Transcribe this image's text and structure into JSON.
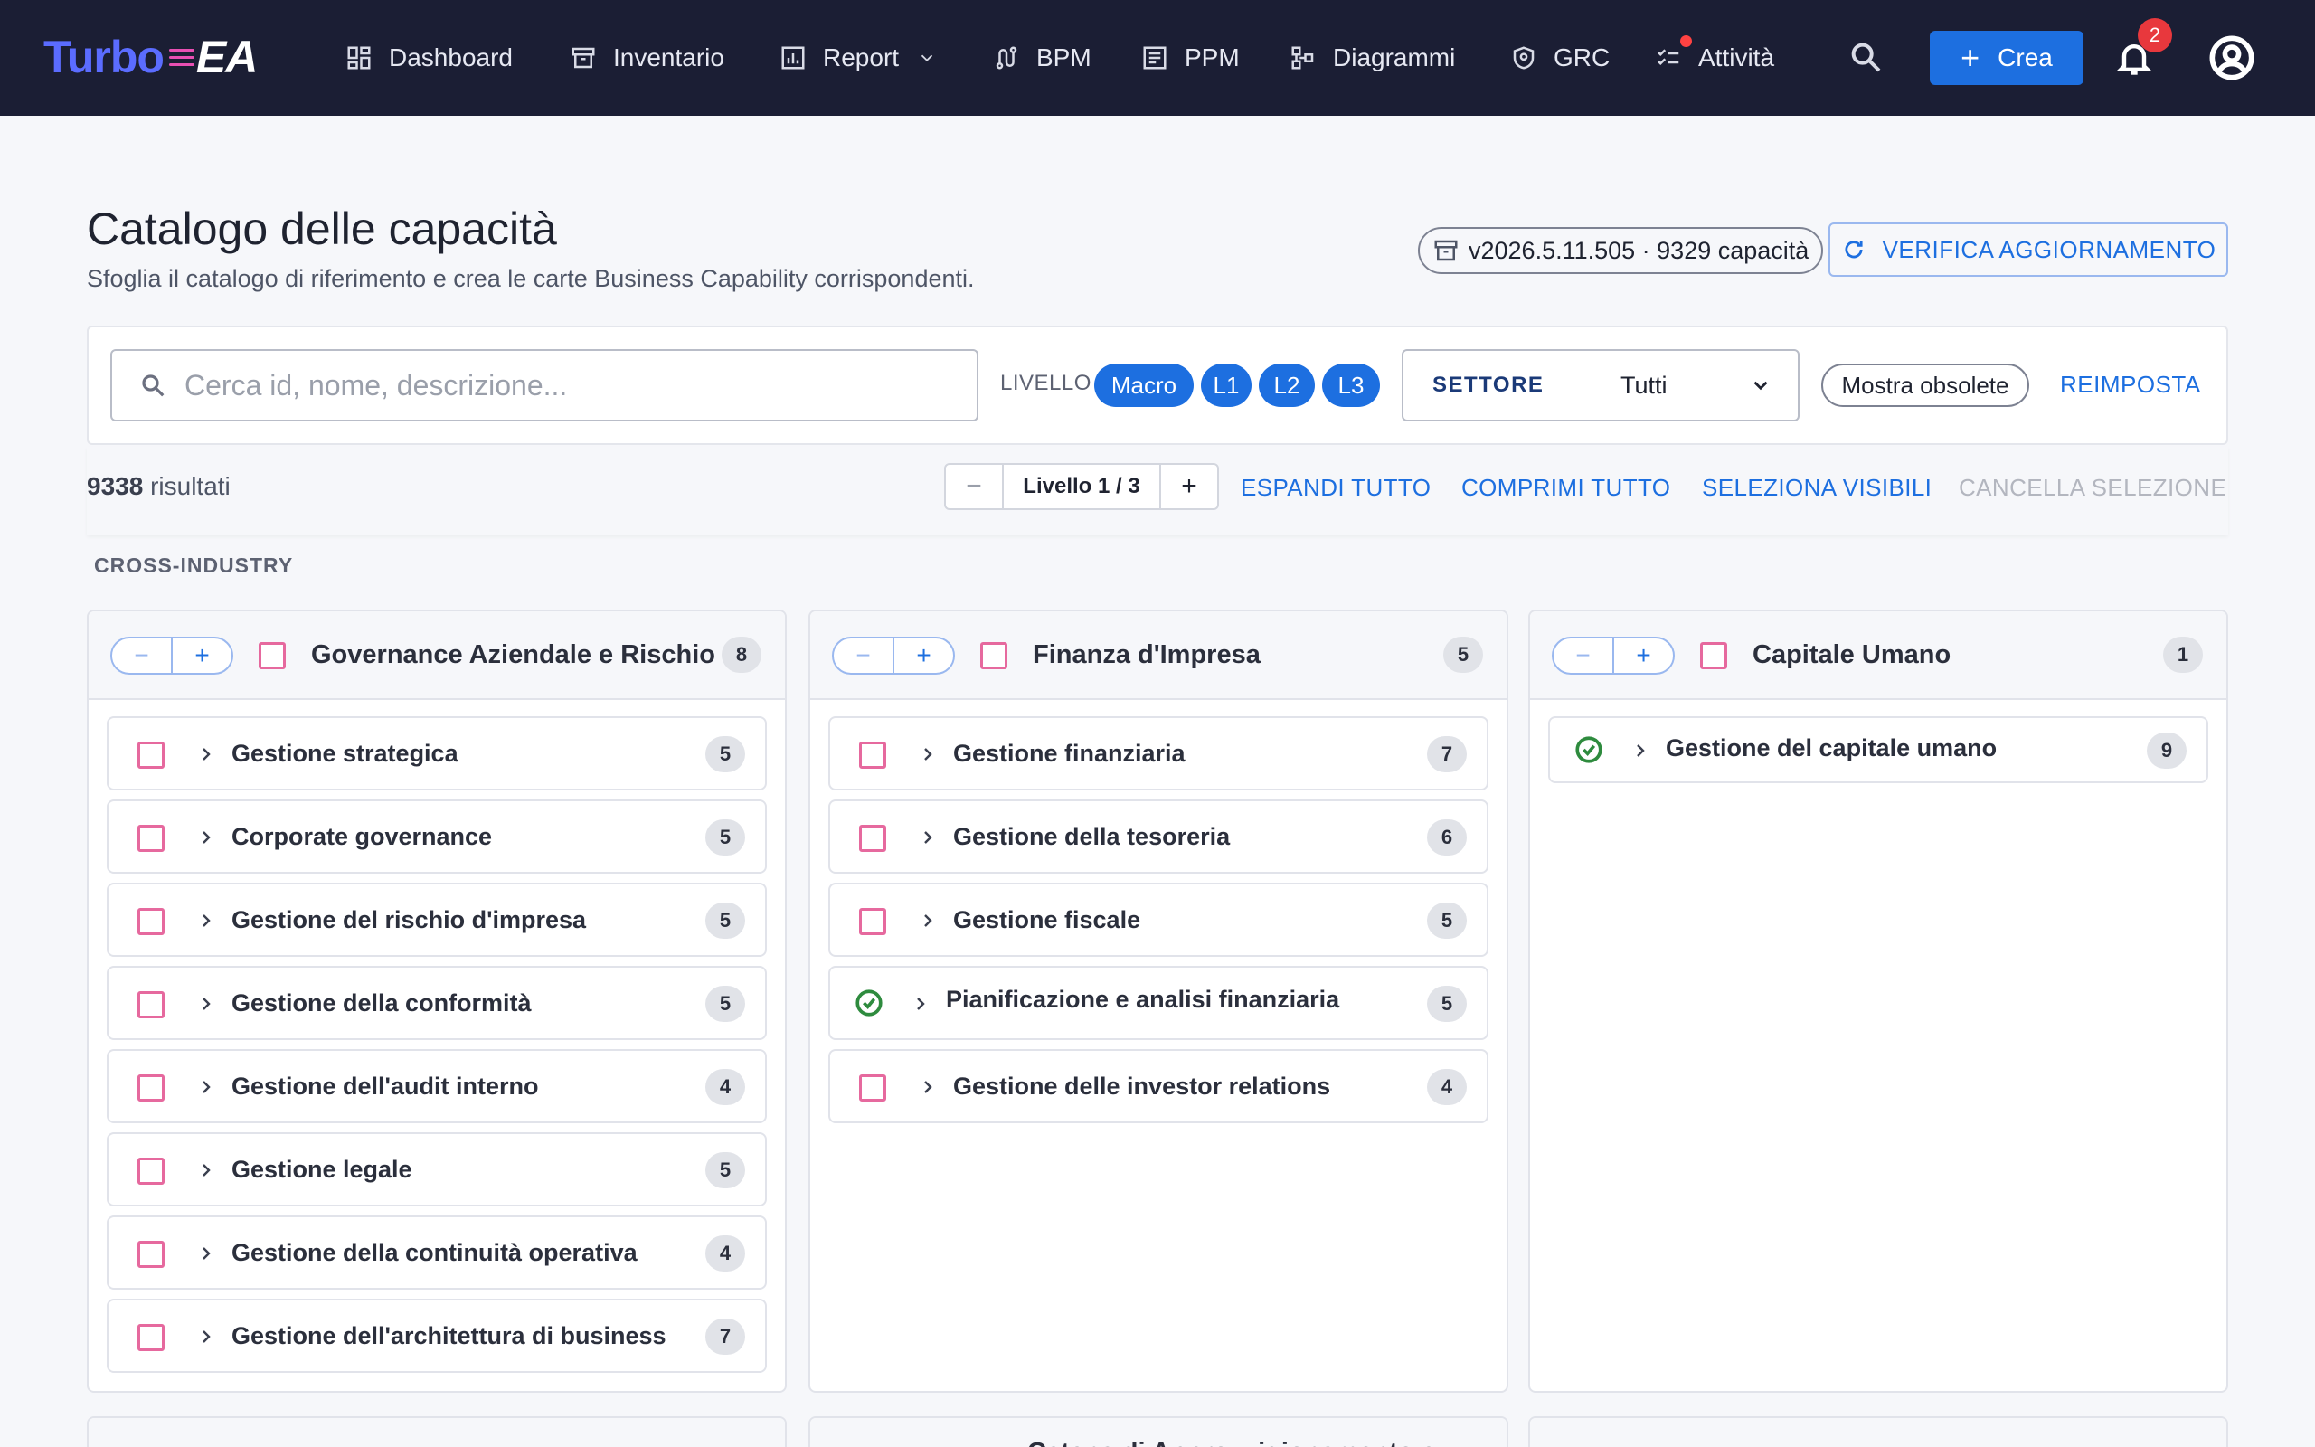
{
  "app": {
    "logo_part1": "Turbo",
    "logo_part2": "EA"
  },
  "nav": {
    "items": [
      {
        "label": "Dashboard",
        "icon": "dashboard-icon"
      },
      {
        "label": "Inventario",
        "icon": "archive-icon"
      },
      {
        "label": "Report",
        "icon": "chart-icon"
      },
      {
        "label": "BPM",
        "icon": "route-icon"
      },
      {
        "label": "PPM",
        "icon": "list-icon"
      },
      {
        "label": "Diagrammi",
        "icon": "diagram-icon"
      },
      {
        "label": "GRC",
        "icon": "shield-icon"
      },
      {
        "label": "Attività",
        "icon": "tasks-icon"
      }
    ],
    "create_label": "Crea",
    "notification_count": "2"
  },
  "header": {
    "title": "Catalogo delle capacità",
    "subtitle": "Sfoglia il catalogo di riferimento e crea le carte Business Capability corrispondenti.",
    "version": "v2026.5.11.505 · 9329 capacità",
    "verify_label": "VERIFICA AGGIORNAMENTO"
  },
  "filters": {
    "search_placeholder": "Cerca id, nome, descrizione...",
    "level_label": "LIVELLO",
    "levels": [
      "Macro",
      "L1",
      "L2",
      "L3"
    ],
    "sector_label": "SETTORE",
    "sector_value": "Tutti",
    "obsolete_label": "Mostra obsolete",
    "reset_label": "REIMPOSTA"
  },
  "results": {
    "count": "9338",
    "count_suffix": " risultati",
    "stepper_label": "Livello 1 / 3",
    "expand_all": "ESPANDI TUTTO",
    "collapse_all": "COMPRIMI TUTTO",
    "select_visible": "SELEZIONA VISIBILI",
    "clear_selection": "CANCELLA SELEZIONE"
  },
  "group": {
    "label": "CROSS-INDUSTRY"
  },
  "columns": [
    {
      "title": "Governance Aziendale e Rischio",
      "count": "8",
      "items": [
        {
          "name": "Gestione strategica",
          "count": "5"
        },
        {
          "name": "Corporate governance",
          "count": "5"
        },
        {
          "name": "Gestione del rischio d'impresa",
          "count": "5"
        },
        {
          "name": "Gestione della conformità",
          "count": "5"
        },
        {
          "name": "Gestione dell'audit interno",
          "count": "4"
        },
        {
          "name": "Gestione legale",
          "count": "5"
        },
        {
          "name": "Gestione della continuità operativa",
          "count": "4"
        },
        {
          "name": "Gestione dell'architettura di business",
          "count": "7"
        }
      ]
    },
    {
      "title": "Finanza d'Impresa",
      "count": "5",
      "items": [
        {
          "name": "Gestione finanziaria",
          "count": "7"
        },
        {
          "name": "Gestione della tesoreria",
          "count": "6"
        },
        {
          "name": "Gestione fiscale",
          "count": "5"
        },
        {
          "name": "Pianificazione e analisi finanziaria",
          "count": "5",
          "existing": true
        },
        {
          "name": "Gestione delle investor relations",
          "count": "4"
        }
      ]
    },
    {
      "title": "Capitale Umano",
      "count": "1",
      "items": [
        {
          "name": "Gestione del capitale umano",
          "count": "9",
          "existing": true
        }
      ]
    }
  ],
  "next_row": {
    "middle_title": "Catena di Approvvigionamento e"
  }
}
